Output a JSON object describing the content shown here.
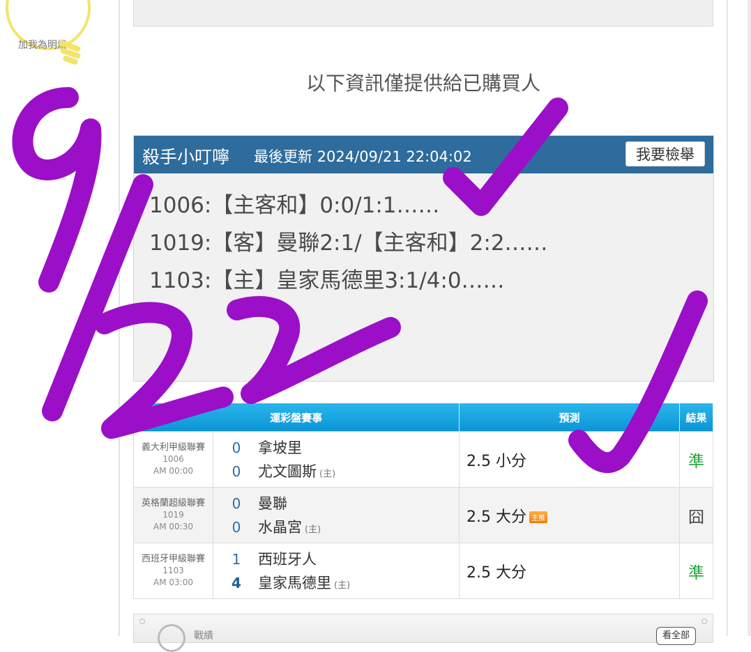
{
  "sidebar": {
    "promo": "加我為明燈"
  },
  "notice": "以下資訊僅提供給已購買人",
  "expert": {
    "name": "殺手小叮嚀",
    "updated": "最後更新 2024/09/21 22:04:02",
    "report_button": "我要檢舉",
    "picks": [
      "1006:【主客和】0:0/1:1……",
      "1019:【客】曼聯2:1/【主客和】2:2……",
      "1103:【主】皇家馬德里3:1/4:0……"
    ]
  },
  "table": {
    "headers": [
      "運彩盤賽事",
      "預測",
      "結果"
    ],
    "host_mark": "(主)",
    "hot_badge": "主推",
    "rows": [
      {
        "league": "義大利甲級聯賽",
        "code": "1006",
        "time": "AM 00:00",
        "away": "拿坡里",
        "away_score": "0",
        "home": "尤文圖斯",
        "home_score": "0",
        "prediction": "2.5 小分",
        "hot": false,
        "result": "準"
      },
      {
        "league": "英格蘭超級聯賽",
        "code": "1019",
        "time": "AM 00:30",
        "away": "曼聯",
        "away_score": "0",
        "home": "水晶宮",
        "home_score": "0",
        "prediction": "2.5 大分",
        "hot": true,
        "result": "囧"
      },
      {
        "league": "西班牙甲級聯賽",
        "code": "1103",
        "time": "AM 03:00",
        "away": "西班牙人",
        "away_score": "1",
        "home": "皇家馬德里",
        "home_score": "4",
        "prediction": "2.5 大分",
        "hot": false,
        "result": "準"
      }
    ]
  },
  "bottom": {
    "label": "戰績",
    "view_all": "看全部"
  },
  "colors": {
    "header_blue": "#2e6c9d",
    "table_header": "#0b95d6",
    "hit_green": "#22a33a",
    "ink_purple": "#9b0fc8",
    "bulb_yellow": "#f3e46a"
  },
  "icons": [
    "lightbulb-icon",
    "record-icon"
  ]
}
